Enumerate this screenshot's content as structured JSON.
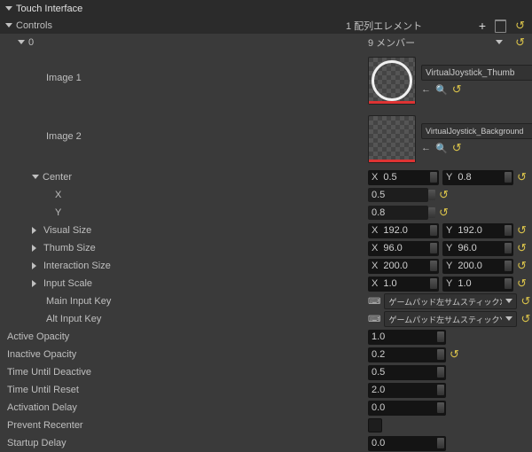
{
  "title": "Touch Interface",
  "controls_label": "Controls",
  "array_count": "1 配列エレメント",
  "array_index": "0",
  "members": "9 メンバー",
  "image1": {
    "label": "Image 1",
    "asset": "VirtualJoystick_Thumb"
  },
  "image2": {
    "label": "Image 2",
    "asset": "VirtualJoystick_Background"
  },
  "center": {
    "label": "Center",
    "x_lbl": "X",
    "y_lbl": "Y",
    "x": "0.5",
    "y": "0.8",
    "x_val": "0.5",
    "y_val": "0.8"
  },
  "visual_size": {
    "label": "Visual Size",
    "x": "192.0",
    "y": "192.0"
  },
  "thumb_size": {
    "label": "Thumb Size",
    "x": "96.0",
    "y": "96.0"
  },
  "interaction_size": {
    "label": "Interaction Size",
    "x": "200.0",
    "y": "200.0"
  },
  "input_scale": {
    "label": "Input Scale",
    "x": "1.0",
    "y": "1.0"
  },
  "main_input_key": {
    "label": "Main Input Key",
    "value": "ゲームパッド左サムスティックX軸"
  },
  "alt_input_key": {
    "label": "Alt Input Key",
    "value": "ゲームパッド左サムスティックY軸"
  },
  "active_opacity": {
    "label": "Active Opacity",
    "value": "1.0"
  },
  "inactive_opacity": {
    "label": "Inactive Opacity",
    "value": "0.2"
  },
  "time_until_deactive": {
    "label": "Time Until Deactive",
    "value": "0.5"
  },
  "time_until_reset": {
    "label": "Time Until Reset",
    "value": "2.0"
  },
  "activation_delay": {
    "label": "Activation Delay",
    "value": "0.0"
  },
  "prevent_recenter": {
    "label": "Prevent Recenter"
  },
  "startup_delay": {
    "label": "Startup Delay",
    "value": "0.0"
  },
  "axis": {
    "x": "X",
    "y": "Y"
  }
}
